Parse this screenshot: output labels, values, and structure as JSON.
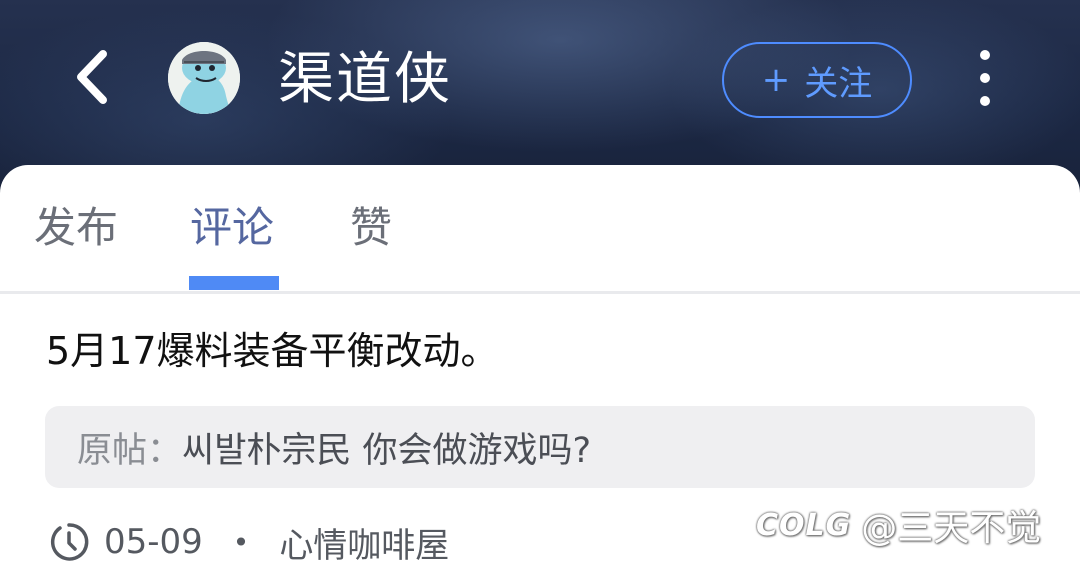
{
  "header": {
    "back_icon": "chevron-left-icon",
    "channel_name": "渠道侠",
    "follow_button": {
      "plus": "+",
      "label": "关注"
    },
    "more_icon": "more-vertical-icon"
  },
  "tabs": [
    {
      "label": "发布",
      "active": false
    },
    {
      "label": "评论",
      "active": true
    },
    {
      "label": "赞",
      "active": false
    }
  ],
  "post": {
    "comment": "5月17爆料装备平衡改动。",
    "quote_label": "原帖：",
    "quote_text": "씨발朴宗民 你会做游戏吗?",
    "date": "05-09",
    "separator": "•",
    "board": "心情咖啡屋"
  },
  "watermark": {
    "logo": "COLG",
    "text": "@三天不觉"
  },
  "colors": {
    "header_bg": "#1c2844",
    "accent": "#4f8af5",
    "follow_border": "#4e8cff",
    "active_tab": "#5567a0"
  }
}
